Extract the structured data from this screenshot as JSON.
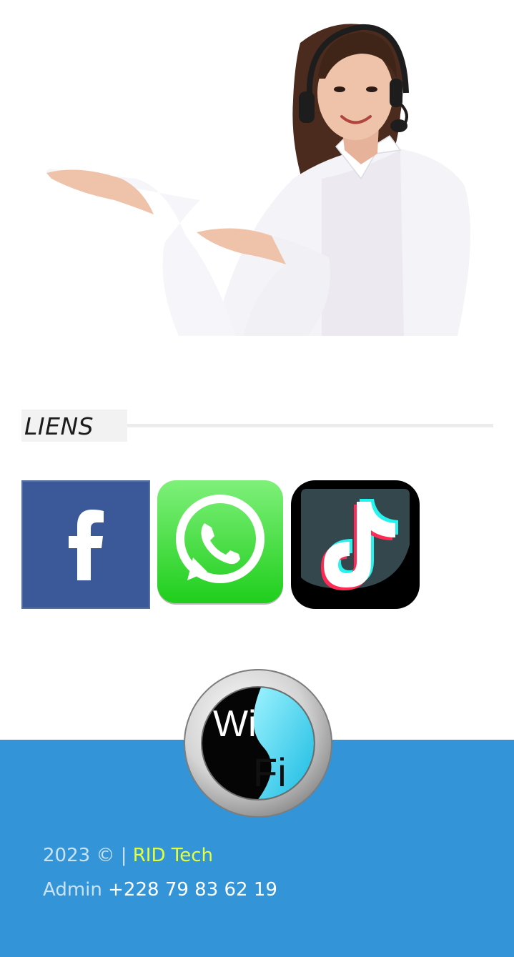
{
  "hero": {
    "image": "customer-support-agent-with-headset"
  },
  "links_section": {
    "title": "LIENS"
  },
  "social": [
    {
      "name": "facebook-icon",
      "color": "#3b5998"
    },
    {
      "name": "whatsapp-icon",
      "color": "#2fd52a"
    },
    {
      "name": "tiktok-icon",
      "color": "#000000"
    }
  ],
  "wifi_logo": {
    "text_top": "Wi",
    "text_bottom": "Fi"
  },
  "footer": {
    "year": "2023",
    "copyright": "©",
    "separator": "|",
    "brand": "RID Tech",
    "admin_label": "Admin",
    "phone": "+228 79 83 62 19",
    "background": "#3395d8",
    "brand_color": "#e4ff3b"
  }
}
